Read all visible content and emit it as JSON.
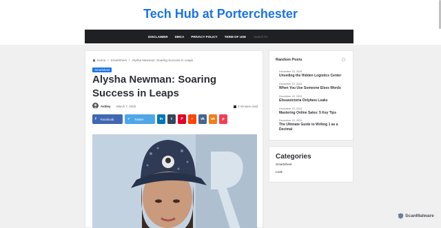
{
  "site": {
    "title": "Tech Hub at Porterchester"
  },
  "nav": {
    "items": [
      "DISCLAIMER",
      "DMCA",
      "PRIVACY POLICY",
      "TERM OF USE"
    ],
    "search_placeholder": "Search for"
  },
  "breadcrumb": {
    "home": "Home",
    "category": "Smartsheet",
    "current": "Alysha Newman: Soaring Success in Leaps"
  },
  "post": {
    "category_badge": "Smartsheet",
    "title": "Alysha Newman: Soaring Success in Leaps",
    "author": "Ashley",
    "date": "March 7, 2025",
    "read_time": "3 minutes read"
  },
  "share": {
    "facebook": "Facebook",
    "twitter": "Twitter",
    "buttons": [
      {
        "name": "share-linkedin",
        "glyph": "in",
        "color": "#0077b5"
      },
      {
        "name": "share-tumblr",
        "glyph": "t",
        "color": "#35465c"
      },
      {
        "name": "share-pinterest",
        "glyph": "P",
        "color": "#e60023"
      },
      {
        "name": "share-reddit",
        "glyph": "r",
        "color": "#ff4500"
      },
      {
        "name": "share-vk",
        "glyph": "vk",
        "color": "#45668e"
      },
      {
        "name": "share-odnoklassniki",
        "glyph": "ok",
        "color": "#ef7f1a"
      },
      {
        "name": "share-pocket",
        "glyph": "p",
        "color": "#ef4056"
      }
    ]
  },
  "sidebar": {
    "random_posts_title": "Random Posts",
    "random_posts": [
      {
        "date": "December 15, 2024",
        "title": "Unveiling the Hidden Logistics Center"
      },
      {
        "date": "December 15, 2024",
        "title": "When You Use Someone Elses Words"
      },
      {
        "date": "December 15, 2024",
        "title": "Elissavictoria Onlyfans Leaks"
      },
      {
        "date": "December 15, 2024",
        "title": "Mastering Online Sales: 5 Key Tips"
      },
      {
        "date": "December 15, 2024",
        "title": "The Ultimate Guide to Writing 1 as a Decimal"
      }
    ],
    "categories_title": "Categories",
    "categories": [
      "Smartsheet",
      "Leak"
    ]
  },
  "watermark": {
    "text": "ScanMalware"
  },
  "colors": {
    "accent": "#1a73e8",
    "nav_bg": "#1f2024",
    "facebook": "#4267b2",
    "twitter": "#4fa7e8"
  }
}
